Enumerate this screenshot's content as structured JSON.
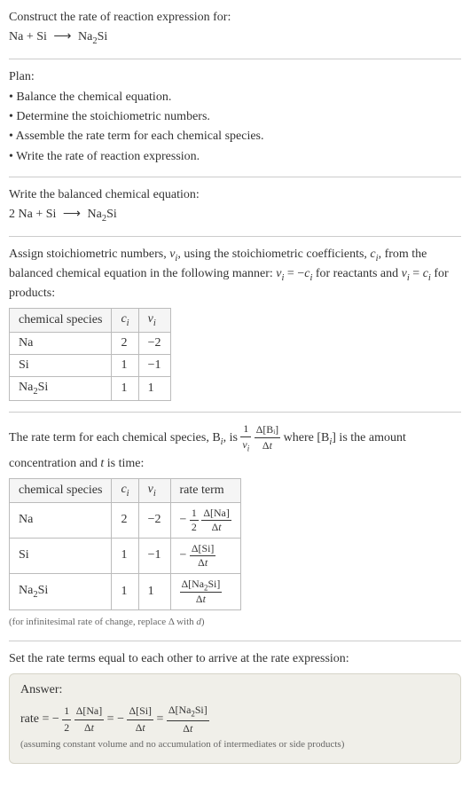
{
  "prompt": {
    "title": "Construct the rate of reaction expression for:",
    "equation_unbalanced_lhs1": "Na",
    "equation_unbalanced_lhs2": "Si",
    "equation_unbalanced_rhs": "Na",
    "equation_unbalanced_rhs_sub": "2",
    "equation_unbalanced_rhs_tail": "Si",
    "arrow": "⟶"
  },
  "plan": {
    "heading": "Plan:",
    "items": [
      "• Balance the chemical equation.",
      "• Determine the stoichiometric numbers.",
      "• Assemble the rate term for each chemical species.",
      "• Write the rate of reaction expression."
    ]
  },
  "balanced": {
    "heading": "Write the balanced chemical equation:",
    "coef1": "2",
    "sp1": "Na",
    "plus": "+",
    "sp2": "Si",
    "arrow": "⟶",
    "sp3a": "Na",
    "sp3sub": "2",
    "sp3b": "Si"
  },
  "stoich": {
    "text_a": "Assign stoichiometric numbers, ",
    "nu_i": "ν",
    "nu_sub": "i",
    "text_b": ", using the stoichiometric coefficients, ",
    "c_i": "c",
    "c_sub": "i",
    "text_c": ", from the balanced chemical equation in the following manner: ",
    "rel1_lhs": "ν",
    "rel1_eq": " = −",
    "rel1_rhs": "c",
    "text_d": " for reactants and ",
    "rel2_lhs": "ν",
    "rel2_eq": " = ",
    "rel2_rhs": "c",
    "text_e": " for products:",
    "headers": [
      "chemical species",
      "cᵢ",
      "νᵢ"
    ],
    "rows": [
      {
        "sp": "Na",
        "sub": "",
        "c": "2",
        "nu": "−2"
      },
      {
        "sp": "Si",
        "sub": "",
        "c": "1",
        "nu": "−1"
      },
      {
        "sp": "Na₂Si",
        "sub": "",
        "c": "1",
        "nu": "1"
      }
    ]
  },
  "rateterm": {
    "text_a": "The rate term for each chemical species, B",
    "text_a_sub": "i",
    "text_b": ", is ",
    "frac1_num": "1",
    "frac1_den_a": "ν",
    "frac1_den_sub": "i",
    "frac2_num": "Δ[Bᵢ]",
    "frac2_den": "Δt",
    "text_c": " where [B",
    "text_c_sub": "i",
    "text_d": "] is the amount concentration and ",
    "t_var": "t",
    "text_e": " is time:",
    "headers": [
      "chemical species",
      "cᵢ",
      "νᵢ",
      "rate term"
    ],
    "rows": [
      {
        "sp": "Na",
        "c": "2",
        "nu": "−2",
        "neg": "−",
        "coef_num": "1",
        "coef_den": "2",
        "d_num": "Δ[Na]",
        "d_den": "Δt"
      },
      {
        "sp": "Si",
        "c": "1",
        "nu": "−1",
        "neg": "−",
        "coef_num": "",
        "coef_den": "",
        "d_num": "Δ[Si]",
        "d_den": "Δt"
      },
      {
        "sp": "Na₂Si",
        "c": "1",
        "nu": "1",
        "neg": "",
        "coef_num": "",
        "coef_den": "",
        "d_num": "Δ[Na₂Si]",
        "d_den": "Δt"
      }
    ],
    "footnote": "(for infinitesimal rate of change, replace Δ with d)"
  },
  "final": {
    "heading": "Set the rate terms equal to each other to arrive at the rate expression:",
    "answer_label": "Answer:",
    "rate_word": "rate = ",
    "t1_neg": "−",
    "t1_coef_num": "1",
    "t1_coef_den": "2",
    "t1_num": "Δ[Na]",
    "t1_den": "Δt",
    "eq": " = ",
    "t2_neg": "−",
    "t2_num": "Δ[Si]",
    "t2_den": "Δt",
    "t3_num": "Δ[Na₂Si]",
    "t3_den": "Δt",
    "assume": "(assuming constant volume and no accumulation of intermediates or side products)"
  },
  "chart_data": {
    "type": "table",
    "tables": [
      {
        "title": "stoichiometric numbers",
        "columns": [
          "chemical species",
          "c_i",
          "nu_i"
        ],
        "rows": [
          [
            "Na",
            2,
            -2
          ],
          [
            "Si",
            1,
            -1
          ],
          [
            "Na2Si",
            1,
            1
          ]
        ]
      },
      {
        "title": "rate terms",
        "columns": [
          "chemical species",
          "c_i",
          "nu_i",
          "rate term"
        ],
        "rows": [
          [
            "Na",
            2,
            -2,
            "-(1/2) * Δ[Na]/Δt"
          ],
          [
            "Si",
            1,
            -1,
            "- Δ[Si]/Δt"
          ],
          [
            "Na2Si",
            1,
            1,
            "Δ[Na2Si]/Δt"
          ]
        ]
      }
    ],
    "rate_expression": "rate = -(1/2) Δ[Na]/Δt = - Δ[Si]/Δt = Δ[Na2Si]/Δt"
  }
}
